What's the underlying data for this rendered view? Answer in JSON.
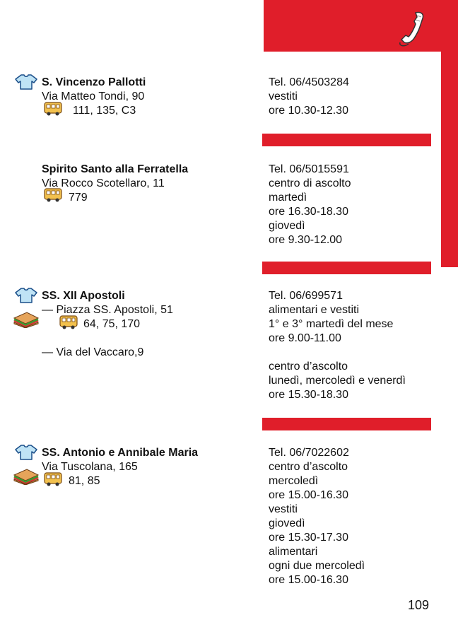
{
  "page_number": "109",
  "entries": [
    {
      "name": "S. Vincenzo Pallotti",
      "address": "Via Matteo Tondi, 90",
      "bus": "111, 135, C3",
      "details": [
        "Tel. 06/4503284",
        "vestiti",
        "ore 10.30-12.30"
      ],
      "icons": [
        "shirt-icon",
        "bus-icon"
      ]
    },
    {
      "name": "Spirito Santo alla Ferratella",
      "address": "Via Rocco Scotellaro, 11",
      "bus": "779",
      "details": [
        "Tel. 06/5015591",
        "centro di ascolto",
        "martedì",
        "ore 16.30-18.30",
        "giovedì",
        "ore 9.30-12.00"
      ],
      "icons": [
        "bus-icon"
      ]
    },
    {
      "name": "SS. XII Apostoli",
      "address": "— Piazza SS. Apostoli, 51",
      "bus": "64, 75, 170",
      "details": [
        "Tel. 06/699571",
        "alimentari e vestiti",
        "1° e 3° martedì del mese",
        "ore 9.00-11.00"
      ],
      "address2": "— Via del Vaccaro,9",
      "details2": [
        "centro d’ascolto",
        "lunedì, mercoledì e venerdì",
        "ore 15.30-18.30"
      ],
      "icons": [
        "shirt-icon",
        "sandwich-icon",
        "bus-icon"
      ]
    },
    {
      "name": "SS. Antonio e Annibale Maria",
      "address": "Via Tuscolana, 165",
      "bus": "81, 85",
      "details": [
        "Tel. 06/7022602",
        "centro d’ascolto",
        "mercoledì",
        "ore 15.00-16.30",
        "vestiti",
        "giovedì",
        "ore 15.30-17.30",
        "alimentari",
        "ogni due mercoledì",
        "ore 15.00-16.30"
      ],
      "icons": [
        "shirt-icon",
        "sandwich-icon",
        "bus-icon"
      ]
    }
  ],
  "colors": {
    "accent": "#e01e2a"
  }
}
